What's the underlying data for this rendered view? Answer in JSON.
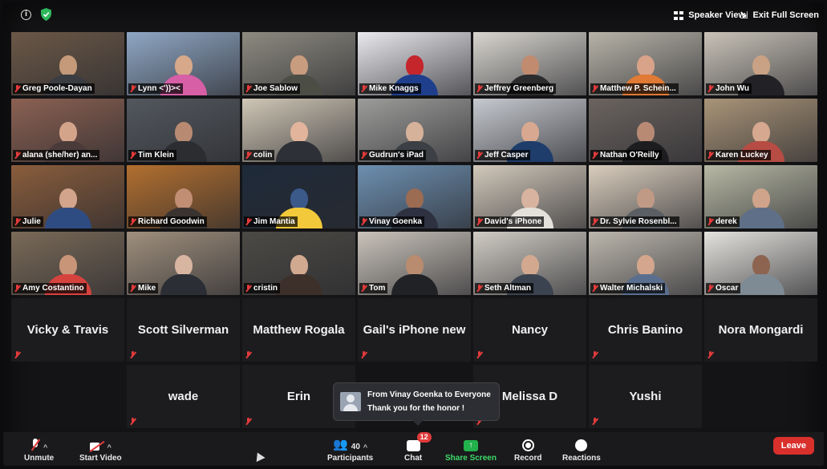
{
  "topbar": {
    "speaker_view_label": "Speaker View",
    "exit_fullscreen_label": "Exit Full Screen"
  },
  "video_tiles": [
    {
      "name": "Greg Poole-Dayan",
      "bg": "#6b5847",
      "skin": "#c49a7a",
      "shirt": "#3a3d42"
    },
    {
      "name": "Lynn <'))><",
      "bg": "#8fa7c4",
      "skin": "#d7a98a",
      "shirt": "#d65fa6"
    },
    {
      "name": "Joe Sablow",
      "bg": "#8d8a80",
      "skin": "#c89c7e",
      "shirt": "#4c4e46",
      "active": true
    },
    {
      "name": "Mike Knaggs",
      "bg": "#e9e9ee",
      "skin": "#c4262c",
      "shirt": "#1f3f8c",
      "logo": "KEEP CALM"
    },
    {
      "name": "Jeffrey Greenberg",
      "bg": "#d8d5cf",
      "skin": "#c08b6f",
      "shirt": "#2c2c2e"
    },
    {
      "name": "Matthew P. Schein...",
      "bg": "#b7b3a8",
      "skin": "#d9a389",
      "shirt": "#e07a35"
    },
    {
      "name": "John Wu",
      "bg": "#c9c3b8",
      "skin": "#c9a184",
      "shirt": "#222226"
    },
    {
      "name": "alana (she/her) an...",
      "bg": "#8b6152",
      "skin": "#d4a48a",
      "shirt": "#4a3b3a"
    },
    {
      "name": "Tim Klein",
      "bg": "#53585e",
      "skin": "#b98a72",
      "shirt": "#2b2d31"
    },
    {
      "name": "colin",
      "bg": "#cfc6b5",
      "skin": "#e2b49b",
      "shirt": "#2d3036"
    },
    {
      "name": "Gudrun's iPad",
      "bg": "#9c9c9a",
      "skin": "#d6b29a",
      "shirt": "#3c3f44"
    },
    {
      "name": "Jeff Casper",
      "bg": "#c6c9cf",
      "skin": "#d8a890",
      "shirt": "#1e3d6b"
    },
    {
      "name": "Nathan O'Reilly",
      "bg": "#6b6460",
      "skin": "#b88a74",
      "shirt": "#1d1d20"
    },
    {
      "name": "Karen Luckey",
      "bg": "#a99478",
      "skin": "#d5a88f",
      "shirt": "#b64c43"
    },
    {
      "name": "Julie",
      "bg": "#8a5d3c",
      "skin": "#d2a48c",
      "shirt": "#2f4c82"
    },
    {
      "name": "Richard Goodwin",
      "bg": "#b26f2f",
      "skin": "#c18e74",
      "shirt": "#3a3431"
    },
    {
      "name": "Jim Mantia",
      "bg": "#1e2a3a",
      "skin": "#3b5a8a",
      "shirt": "#f2c93a"
    },
    {
      "name": "Vinay Goenka",
      "bg": "#6d8fb0",
      "skin": "#9b6c52",
      "shirt": "#2d3140"
    },
    {
      "name": "David's iPhone",
      "bg": "#d2c9bb",
      "skin": "#d8b3a0",
      "shirt": "#e4e1da"
    },
    {
      "name": "Dr. Sylvie Rosenbl...",
      "bg": "#d9cdbd",
      "skin": "#c19a86",
      "shirt": "#5b5f63"
    },
    {
      "name": "derek",
      "bg": "#b7b8a4",
      "skin": "#d0a48a",
      "shirt": "#5e6f87"
    },
    {
      "name": "Amy Costantino",
      "bg": "#7a6a58",
      "skin": "#c99578",
      "shirt": "#d6433f"
    },
    {
      "name": "Mike",
      "bg": "#9f8f7d",
      "skin": "#d7b5a0",
      "shirt": "#2b2e35"
    },
    {
      "name": "cristin",
      "bg": "#4c4a45",
      "skin": "#d1a890",
      "shirt": "#3d2f2a"
    },
    {
      "name": "Tom",
      "bg": "#c9c3ba",
      "skin": "#b98b6f",
      "shirt": "#202226"
    },
    {
      "name": "Seth Altman",
      "bg": "#d0ccc4",
      "skin": "#d2a98f",
      "shirt": "#3c4350"
    },
    {
      "name": "Walter Michalski",
      "bg": "#bcb7ad",
      "skin": "#d3a68d",
      "shirt": "#5a6f8f"
    },
    {
      "name": "Oscar",
      "bg": "#e4e2dd",
      "skin": "#8c6450",
      "shirt": "#7e8b94"
    }
  ],
  "name_tiles": [
    {
      "name": "Vicky & Travis"
    },
    {
      "name": "Scott Silverman"
    },
    {
      "name": "Matthew Rogala"
    },
    {
      "name": "Gail's iPhone new"
    },
    {
      "name": "Nancy"
    },
    {
      "name": "Chris Banino"
    },
    {
      "name": "Nora Mongardi"
    },
    {
      "name": ""
    },
    {
      "name": "wade"
    },
    {
      "name": "Erin"
    },
    {
      "name": ""
    },
    {
      "name": "Melissa D"
    },
    {
      "name": "Yushi"
    },
    {
      "name": ""
    }
  ],
  "chat_popup": {
    "from": "From Vinay Goenka to Everyone",
    "message": "Thank you for the honor !"
  },
  "toolbar": {
    "unmute_label": "Unmute",
    "start_video_label": "Start Video",
    "participants_label": "Participants",
    "participants_count": "40",
    "chat_label": "Chat",
    "chat_badge": "12",
    "share_screen_label": "Share Screen",
    "record_label": "Record",
    "reactions_label": "Reactions",
    "leave_label": "Leave"
  }
}
